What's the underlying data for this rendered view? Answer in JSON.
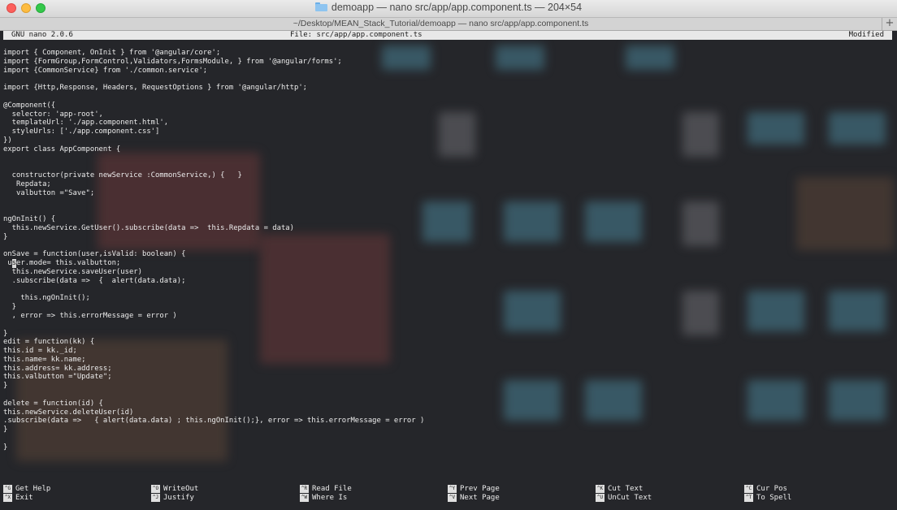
{
  "window": {
    "title": "demoapp — nano src/app/app.component.ts — 204×54",
    "tab_title": "~/Desktop/MEAN_Stack_Tutorial/demoapp — nano src/app/app.component.ts",
    "new_tab_label": "+"
  },
  "nano": {
    "version": "GNU nano 2.0.6",
    "file": "File: src/app/app.component.ts",
    "status": "Modified"
  },
  "code": [
    "import { Component, OnInit } from '@angular/core';",
    "import {FormGroup,FormControl,Validators,FormsModule, } from '@angular/forms';",
    "import {CommonService} from './common.service';",
    "",
    "import {Http,Response, Headers, RequestOptions } from '@angular/http';",
    "",
    "@Component({",
    "  selector: 'app-root',",
    "  templateUrl: './app.component.html',",
    "  styleUrls: ['./app.component.css']",
    "})",
    "export class AppComponent {",
    "",
    "",
    "  constructor(private newService :CommonService,) {   }",
    "   Repdata;",
    "   valbutton =\"Save\";",
    "",
    "",
    "ngOnInit() {",
    "  this.newService.GetUser().subscribe(data =>  this.Repdata = data)",
    "}",
    "",
    "onSave = function(user,isValid: boolean) {",
    " user.mode= this.valbutton;",
    "  this.newService.saveUser(user)",
    "  .subscribe(data =>  {  alert(data.data);",
    "",
    "    this.ngOnInit();",
    "  }",
    "  , error => this.errorMessage = error )",
    "",
    "}",
    "edit = function(kk) {",
    "this.id = kk._id;",
    "this.name= kk.name;",
    "this.address= kk.address;",
    "this.valbutton =\"Update\";",
    "}",
    "",
    "delete = function(id) {",
    "this.newService.deleteUser(id)",
    ".subscribe(data =>   { alert(data.data) ; this.ngOnInit();}, error => this.errorMessage = error )",
    "}",
    "",
    "}"
  ],
  "cursor": {
    "line": 24,
    "col": 2
  },
  "shortcuts": [
    {
      "key": "^G",
      "label": "Get Help"
    },
    {
      "key": "^X",
      "label": "Exit"
    },
    {
      "key": "^O",
      "label": "WriteOut"
    },
    {
      "key": "^J",
      "label": "Justify"
    },
    {
      "key": "^R",
      "label": "Read File"
    },
    {
      "key": "^W",
      "label": "Where Is"
    },
    {
      "key": "^Y",
      "label": "Prev Page"
    },
    {
      "key": "^V",
      "label": "Next Page"
    },
    {
      "key": "^K",
      "label": "Cut Text"
    },
    {
      "key": "^U",
      "label": "UnCut Text"
    },
    {
      "key": "^C",
      "label": "Cur Pos"
    },
    {
      "key": "^T",
      "label": "To Spell"
    }
  ]
}
